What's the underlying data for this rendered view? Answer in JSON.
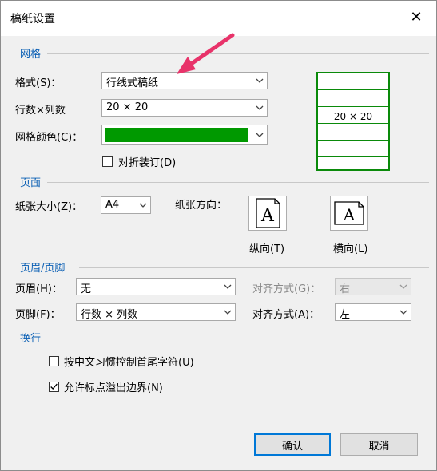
{
  "window": {
    "title": "稿纸设置",
    "close_icon": "close-icon"
  },
  "grid": {
    "section_label": "网格",
    "format_label": "格式(S)：",
    "format_value": "行线式稿纸",
    "rows_cols_label": "行数×列数",
    "rows_cols_value": "20 × 20",
    "color_label": "网格颜色(C)：",
    "color_value": "#009900",
    "fold_label": "对折装订(D)",
    "fold_checked": false,
    "preview_text": "20 × 20"
  },
  "page": {
    "section_label": "页面",
    "size_label": "纸张大小(Z)：",
    "size_value": "A4",
    "orientation_label": "纸张方向：",
    "portrait_label": "纵向(T)",
    "landscape_label": "横向(L)"
  },
  "header_footer": {
    "section_label": "页眉/页脚",
    "header_label": "页眉(H)：",
    "header_value": "无",
    "header_align_label": "对齐方式(G)：",
    "header_align_value": "右",
    "footer_label": "页脚(F)：",
    "footer_value": "行数 × 列数",
    "footer_align_label": "对齐方式(A)：",
    "footer_align_value": "左"
  },
  "wrap": {
    "section_label": "换行",
    "option1_label": "按中文习惯控制首尾字符(U)",
    "option1_checked": false,
    "option2_label": "允许标点溢出边界(N)",
    "option2_checked": true
  },
  "buttons": {
    "ok_label": "确认",
    "cancel_label": "取消"
  },
  "colors": {
    "accent": "#0a5fb4",
    "grid_green": "#009900",
    "annotation_arrow": "#e8336a"
  }
}
